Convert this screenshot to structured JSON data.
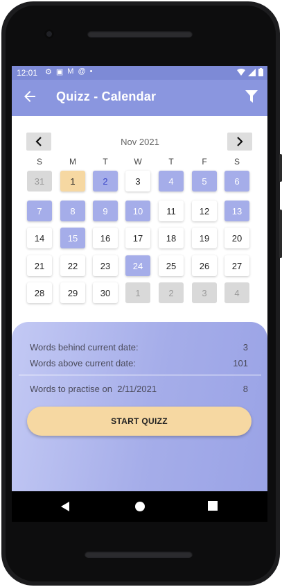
{
  "status_bar": {
    "time": "12:01",
    "left_icons": [
      "gear-icon",
      "sim-off-icon",
      "gmail-icon",
      "at-sign-icon",
      "dot-icon"
    ],
    "right_icons": [
      "wifi-icon",
      "signal-icon",
      "battery-icon"
    ]
  },
  "app_bar": {
    "title": "Quizz - Calendar",
    "back_icon": "arrow-left-icon",
    "filter_icon": "filter-icon"
  },
  "calendar": {
    "month_label": "Nov 2021",
    "prev_icon": "chevron-left-icon",
    "next_icon": "chevron-right-icon",
    "weekdays": [
      "S",
      "M",
      "T",
      "W",
      "T",
      "F",
      "S"
    ],
    "weeks": [
      [
        {
          "d": "31",
          "s": "other"
        },
        {
          "d": "1",
          "s": "today"
        },
        {
          "d": "2",
          "s": "sel-blue"
        },
        {
          "d": "3",
          "s": "normal"
        },
        {
          "d": "4",
          "s": "sel"
        },
        {
          "d": "5",
          "s": "sel"
        },
        {
          "d": "6",
          "s": "sel"
        }
      ],
      [
        {
          "d": "7",
          "s": "sel"
        },
        {
          "d": "8",
          "s": "sel"
        },
        {
          "d": "9",
          "s": "sel"
        },
        {
          "d": "10",
          "s": "sel"
        },
        {
          "d": "11",
          "s": "normal"
        },
        {
          "d": "12",
          "s": "normal"
        },
        {
          "d": "13",
          "s": "sel"
        }
      ],
      [
        {
          "d": "14",
          "s": "normal"
        },
        {
          "d": "15",
          "s": "sel"
        },
        {
          "d": "16",
          "s": "normal"
        },
        {
          "d": "17",
          "s": "normal"
        },
        {
          "d": "18",
          "s": "normal"
        },
        {
          "d": "19",
          "s": "normal"
        },
        {
          "d": "20",
          "s": "normal"
        }
      ],
      [
        {
          "d": "21",
          "s": "normal"
        },
        {
          "d": "22",
          "s": "normal"
        },
        {
          "d": "23",
          "s": "normal"
        },
        {
          "d": "24",
          "s": "sel"
        },
        {
          "d": "25",
          "s": "normal"
        },
        {
          "d": "26",
          "s": "normal"
        },
        {
          "d": "27",
          "s": "normal"
        }
      ],
      [
        {
          "d": "28",
          "s": "normal"
        },
        {
          "d": "29",
          "s": "normal"
        },
        {
          "d": "30",
          "s": "normal"
        },
        {
          "d": "1",
          "s": "other"
        },
        {
          "d": "2",
          "s": "other"
        },
        {
          "d": "3",
          "s": "other"
        },
        {
          "d": "4",
          "s": "other"
        }
      ]
    ]
  },
  "summary": {
    "behind_label": "Words behind current date:",
    "behind_value": "3",
    "above_label": "Words above current date:",
    "above_value": "101",
    "practise_label": "Words to practise on",
    "practise_date": "2/11/2021",
    "practise_value": "8"
  },
  "start_button": {
    "label": "START QUIZZ"
  },
  "nav_bar": {
    "icons": [
      "back-triangle-icon",
      "home-circle-icon",
      "recents-square-icon"
    ]
  },
  "colors": {
    "primary": "#8a96df",
    "status_bar": "#7d8ad6",
    "selected_day": "#a5ade9",
    "today": "#f6d8a2",
    "other_month": "#d9d9d9",
    "button": "#f6d8a2"
  }
}
